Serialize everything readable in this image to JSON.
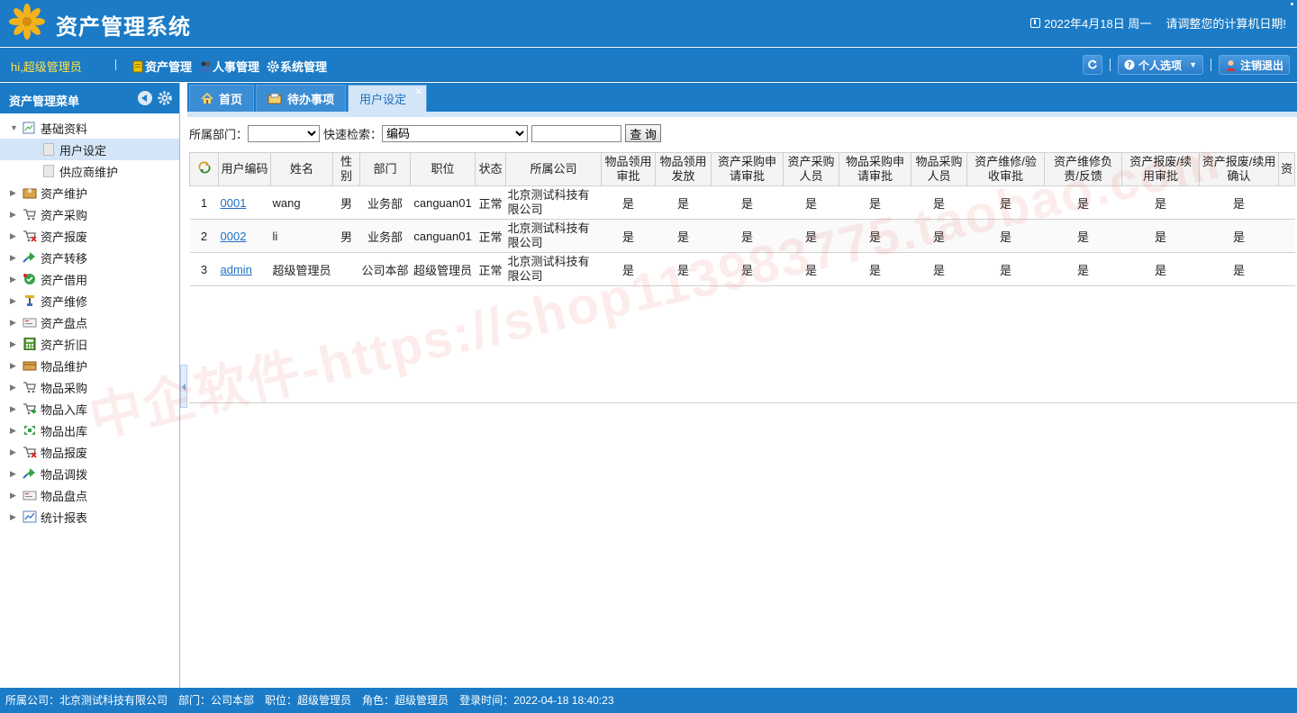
{
  "header": {
    "title": "资产管理系统",
    "date": "2022年4月18日 周一",
    "warning": "请调整您的计算机日期!",
    "brand_color": "#1b7bc6"
  },
  "menubar": {
    "greeting": "hi,超级管理员",
    "menus": [
      "资产管理",
      "人事管理",
      "系统管理"
    ],
    "personal_options": "个人选项",
    "logout": "注销退出"
  },
  "sidebar": {
    "title": "资产管理菜单",
    "groups": [
      {
        "label": "基础资料",
        "icon": "doc-chart-icon",
        "expanded": true,
        "children": [
          {
            "label": "用户设定",
            "selected": true
          },
          {
            "label": "供应商维护",
            "selected": false
          }
        ]
      },
      {
        "label": "资产维护",
        "icon": "box-icon"
      },
      {
        "label": "资产采购",
        "icon": "cart-icon"
      },
      {
        "label": "资产报废",
        "icon": "cart-delete-icon"
      },
      {
        "label": "资产转移",
        "icon": "transfer-icon"
      },
      {
        "label": "资产借用",
        "icon": "borrow-icon"
      },
      {
        "label": "资产维修",
        "icon": "repair-icon"
      },
      {
        "label": "资产盘点",
        "icon": "inventory-icon"
      },
      {
        "label": "资产折旧",
        "icon": "calculator-icon"
      },
      {
        "label": "物品维护",
        "icon": "package-icon"
      },
      {
        "label": "物品采购",
        "icon": "cart-icon"
      },
      {
        "label": "物品入库",
        "icon": "cart-in-icon"
      },
      {
        "label": "物品出库",
        "icon": "expand-arrows-icon"
      },
      {
        "label": "物品报废",
        "icon": "cart-delete-icon"
      },
      {
        "label": "物品调拨",
        "icon": "transfer-icon"
      },
      {
        "label": "物品盘点",
        "icon": "inventory-icon"
      },
      {
        "label": "统计报表",
        "icon": "chart-line-icon"
      }
    ]
  },
  "tabs": [
    {
      "label": "首页",
      "icon": "home-icon"
    },
    {
      "label": "待办事项",
      "icon": "todo-icon"
    },
    {
      "label": "用户设定",
      "active": true
    }
  ],
  "toolbar": {
    "dept_label": "所属部门：",
    "dept_value": "",
    "quick_label": "快速检索：",
    "quick_value": "编码",
    "search_value": "",
    "query_button": "查 询"
  },
  "table": {
    "columns": [
      "用户编码",
      "姓名",
      "性别",
      "部门",
      "职位",
      "状态",
      "所属公司",
      "物品领用审批",
      "物品领用发放",
      "资产采购申请审批",
      "资产采购人员",
      "物品采购申请审批",
      "物品采购人员",
      "资产维修/验收审批",
      "资产维修负责/反馈",
      "资产报废/续用审批",
      "资产报废/续用确认",
      "资"
    ],
    "rows": [
      [
        "1",
        "0001",
        "wang",
        "男",
        "业务部",
        "canguan01",
        "正常",
        "北京测试科技有限公司",
        "是",
        "是",
        "是",
        "是",
        "是",
        "是",
        "是",
        "是",
        "是",
        "是"
      ],
      [
        "2",
        "0002",
        "li",
        "男",
        "业务部",
        "canguan01",
        "正常",
        "北京测试科技有限公司",
        "是",
        "是",
        "是",
        "是",
        "是",
        "是",
        "是",
        "是",
        "是",
        "是"
      ],
      [
        "3",
        "admin",
        "超级管理员",
        "",
        "公司本部",
        "超级管理员",
        "正常",
        "北京测试科技有限公司",
        "是",
        "是",
        "是",
        "是",
        "是",
        "是",
        "是",
        "是",
        "是",
        "是"
      ]
    ]
  },
  "watermark": "中企软件-https://shop113983775.taobao.com",
  "statusbar": {
    "company": "所属公司：北京测试科技有限公司",
    "dept": "部门：公司本部",
    "position": "职位：超级管理员",
    "role": "角色：超级管理员",
    "login_time": "登录时间：2022-04-18 18:40:23"
  }
}
